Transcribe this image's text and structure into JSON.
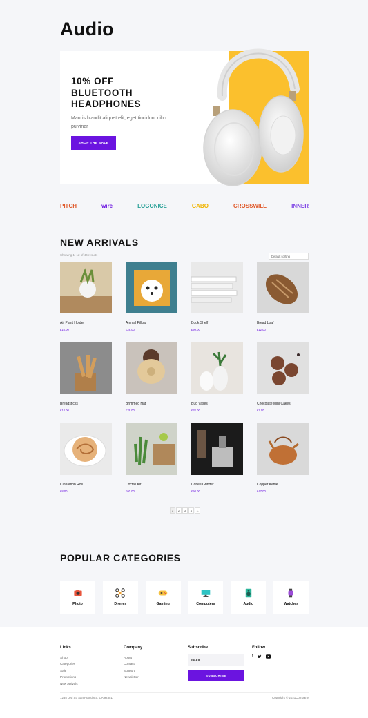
{
  "page": {
    "title": "Audio"
  },
  "hero": {
    "title": "10% OFF\nBLUETOOTH\nHEADPHONES",
    "description": "Mauris blandit aliquet elit, eget tincidunt nibh pulvinar",
    "button": "SHOP THE SALE",
    "accent": "#fbc02d"
  },
  "brands": [
    {
      "name": "PITCH",
      "color": "#e05a2b"
    },
    {
      "name": "wire",
      "color": "#6b14e0"
    },
    {
      "name": "LOGONICE",
      "color": "#2aa198"
    },
    {
      "name": "GABO",
      "color": "#f0b400"
    },
    {
      "name": "CROSSWILL",
      "color": "#e05a2b"
    },
    {
      "name": "INNER",
      "color": "#7b3fe4"
    }
  ],
  "arrivals": {
    "title": "NEW ARRIVALS",
    "count": "Showing 1–12 of 44 results",
    "sort": "Default sorting",
    "products": [
      {
        "name": "Air Plant Holder",
        "price": "£16.00"
      },
      {
        "name": "Animal Pillow",
        "price": "£28.00"
      },
      {
        "name": "Book Shelf",
        "price": "£99.00"
      },
      {
        "name": "Bread Loaf",
        "price": "£12.00"
      },
      {
        "name": "Breadsticks",
        "price": "£14.00"
      },
      {
        "name": "Brimmed Hat",
        "price": "£29.00"
      },
      {
        "name": "Bud Vases",
        "price": "£32.00"
      },
      {
        "name": "Chocolate Mini Cakes",
        "price": "£7.00"
      },
      {
        "name": "Cinnamon Roll",
        "price": "£8.00"
      },
      {
        "name": "Coctail Kit",
        "price": "£60.00"
      },
      {
        "name": "Coffee Grinder",
        "price": "£50.00"
      },
      {
        "name": "Copper Kettle",
        "price": "£47.00"
      }
    ],
    "pages": [
      "1",
      "2",
      "3",
      "4",
      "→"
    ]
  },
  "categories": {
    "title": "POPULAR CATEGORIES",
    "items": [
      {
        "label": "Photo",
        "icon": "camera-icon"
      },
      {
        "label": "Drones",
        "icon": "drone-icon"
      },
      {
        "label": "Gaming",
        "icon": "gamepad-icon"
      },
      {
        "label": "Computers",
        "icon": "monitor-icon"
      },
      {
        "label": "Audio",
        "icon": "speaker-icon"
      },
      {
        "label": "Watches",
        "icon": "watch-icon"
      }
    ]
  },
  "footer": {
    "links": {
      "title": "Links",
      "items": [
        "Shop",
        "Categories",
        "Sale",
        "Promotions",
        "New Arrivals"
      ]
    },
    "company": {
      "title": "Company",
      "items": [
        "About",
        "Contact",
        "Support",
        "Newsletter"
      ]
    },
    "subscribe": {
      "title": "Subscribe",
      "placeholder": "EMAIL",
      "button": "SUBSCRIBE"
    },
    "follow": {
      "title": "Follow",
      "icons": [
        "facebook-icon",
        "twitter-icon",
        "youtube-icon"
      ]
    },
    "address": "1235 Divi St, San Francisco, CA 92351",
    "copyright": "Copyright © 2021Company"
  }
}
